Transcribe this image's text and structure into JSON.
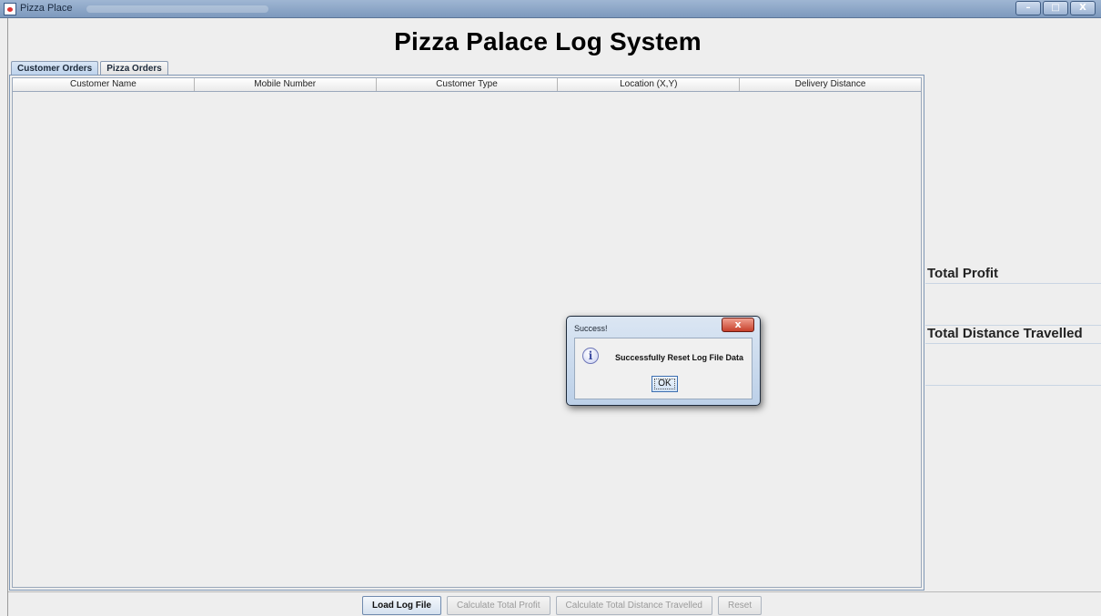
{
  "window": {
    "title": "Pizza Place",
    "minimize_glyph": "–",
    "maximize_glyph": "□",
    "close_glyph": "X",
    "icon": "java-cup-icon"
  },
  "app": {
    "heading": "Pizza Palace Log System"
  },
  "tabs": [
    {
      "label": "Customer Orders",
      "selected": true
    },
    {
      "label": "Pizza Orders",
      "selected": false
    }
  ],
  "table": {
    "columns": [
      "Customer Name",
      "Mobile Number",
      "Customer Type",
      "Location (X,Y)",
      "Delivery Distance"
    ],
    "rows": []
  },
  "side": {
    "profit_label": "Total Profit",
    "profit_value": "",
    "distance_label": "Total Distance Travelled",
    "distance_value": ""
  },
  "buttons": {
    "load": "Load Log File",
    "profit": "Calculate Total Profit",
    "distance": "Calculate Total Distance Travelled",
    "reset": "Reset"
  },
  "dialog": {
    "title": "Success!",
    "close_glyph": "x",
    "message": "Successfully Reset Log File Data",
    "ok_label": "OK",
    "icon": "info-icon"
  }
}
